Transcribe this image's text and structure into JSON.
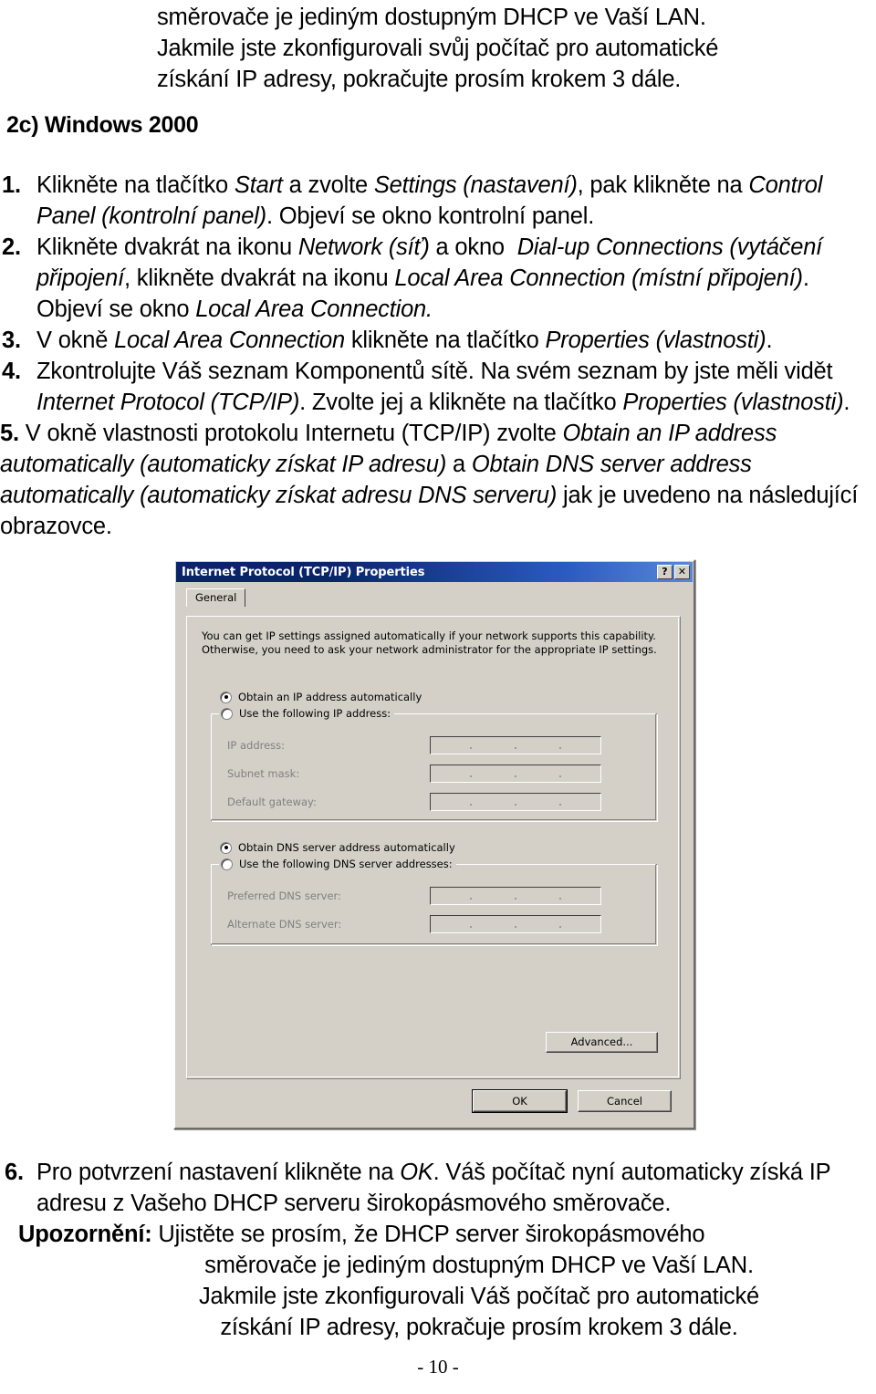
{
  "document": {
    "intro_lines": [
      "směrovače je jediným dostupným DHCP ve Vaší LAN.",
      "Jakmile jste zkonfigurovali svůj počítač pro automatické",
      "získání IP adresy, pokračujte prosím krokem 3 dále."
    ],
    "section_heading": "2c) Windows 2000",
    "steps": [
      {
        "number": "1.",
        "html": "Klikněte na tlačítko <i class=\"it\">Start</i> a zvolte <i class=\"it\">Settings (nastavení)</i>, pak klikněte na <i class=\"it\">Control Panel (kontrolní panel)</i>. Objeví se okno kontrolní panel."
      },
      {
        "number": "2.",
        "html": "Klikněte dvakrát na ikonu <i class=\"it\">Network (síť)</i> a okno&nbsp; <i class=\"it\">Dial-up Connections (vytáčení připojení</i>, klikněte dvakrát na ikonu <i class=\"it\">Local Area Connection (místní připojení)</i>. Objeví se okno <i class=\"it\">Local Area Connection.</i>"
      },
      {
        "number": "3.",
        "html": "V okně <i class=\"it\">Local Area Connection</i> klikněte na tlačítko <i class=\"it\">Properties (vlastnosti)</i>."
      },
      {
        "number": "4.",
        "html": "Zkontrolujte Váš seznam Komponentů sítě. Na svém seznam by jste měli vidět <i class=\"it\">Internet Protocol (TCP/IP)</i>. Zvolte jej a klikněte na tlačítko <i class=\"it\">Properties (vlastnosti)</i>."
      },
      {
        "number": "5.",
        "html": "V okně vlastnosti protokolu Internetu (TCP/IP) zvolte <i class=\"it\">Obtain an IP address automatically (automaticky získat IP adresu)</i> a <i class=\"it\">Obtain DNS server address automatically (automaticky získat adresu DNS serveru)</i> jak je uvedeno na následující obrazovce."
      }
    ],
    "tail_step": {
      "number": "6.",
      "html": "Pro potvrzení nastavení klikněte na <i class=\"it\">OK</i>. Váš počítač nyní automaticky získá IP adresu z Vašeho DHCP serveru širokopásmového směrovače."
    },
    "notice": {
      "label": "Upozornění:",
      "first_line": " Ujistěte se prosím, že DHCP server širokopásmového",
      "rest_lines": [
        "směrovače je jediným dostupným DHCP ve Vaší LAN.",
        "Jakmile jste zkonfigurovali Váš počítač pro automatické",
        "získání IP adresy, pokračuje prosím krokem 3 dále."
      ]
    },
    "page_number": "- 10 -"
  },
  "dialog": {
    "title": "Internet Protocol (TCP/IP) Properties",
    "help_button": "?",
    "close_button": "✕",
    "tab_general": "General",
    "description": "You can get IP settings assigned automatically if your network supports this capability. Otherwise, you need to ask your network administrator for the appropriate IP settings.",
    "ip_auto_radio": "Obtain an IP address automatically",
    "ip_manual_radio": "Use the following IP address:",
    "ip_fields": [
      {
        "label": "IP address:",
        "value": ""
      },
      {
        "label": "Subnet mask:",
        "value": ""
      },
      {
        "label": "Default gateway:",
        "value": ""
      }
    ],
    "dns_auto_radio": "Obtain DNS server address automatically",
    "dns_manual_radio": "Use the following DNS server addresses:",
    "dns_fields": [
      {
        "label": "Preferred DNS server:",
        "value": ""
      },
      {
        "label": "Alternate DNS server:",
        "value": ""
      }
    ],
    "advanced_button": "Advanced...",
    "ok_button": "OK",
    "cancel_button": "Cancel",
    "colors": {
      "face": "#d4d0c8",
      "title_start": "#0a246a",
      "title_end": "#5a87d8",
      "disabled_text": "#808080"
    }
  }
}
